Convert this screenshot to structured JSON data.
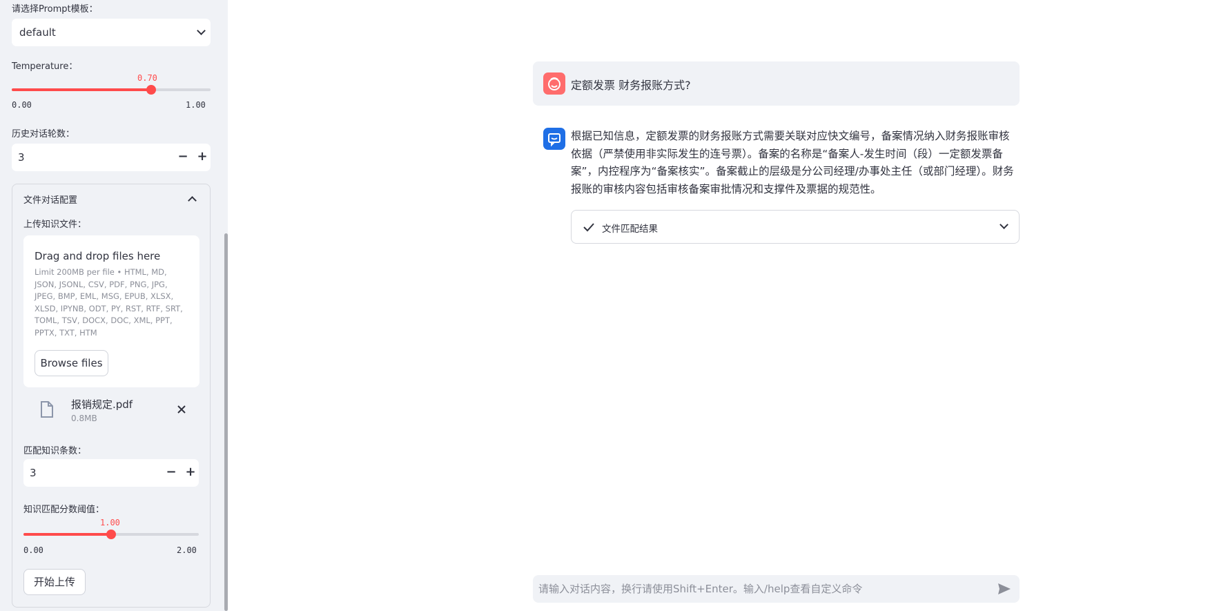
{
  "sidebar": {
    "prompt_template_label": "请选择Prompt模板：",
    "prompt_template_value": "default",
    "temperature_label": "Temperature：",
    "temperature_value": "0.70",
    "temperature_min": "0.00",
    "temperature_max": "1.00",
    "temperature_fraction": 0.7,
    "history_label": "历史对话轮数：",
    "history_value": "3",
    "file_config": {
      "title": "文件对话配置",
      "upload_label": "上传知识文件：",
      "drop_title": "Drag and drop files here",
      "drop_limit": "Limit 200MB per file • HTML, MD, JSON, JSONL, CSV, PDF, PNG, JPG, JPEG, BMP, EML, MSG, EPUB, XLSX, XLSD, IPYNB, ODT, PY, RST, RTF, SRT, TOML, TSV, DOCX, DOC, XML, PPT, PPTX, TXT, HTM",
      "browse_label": "Browse files",
      "file_name": "报销规定.pdf",
      "file_size": "0.8MB",
      "topk_label": "匹配知识条数：",
      "topk_value": "3",
      "threshold_label": "知识匹配分数阈值：",
      "threshold_value": "1.00",
      "threshold_min": "0.00",
      "threshold_max": "2.00",
      "threshold_fraction": 0.5,
      "upload_button": "开始上传"
    }
  },
  "chat": {
    "user_message": "定额发票 财务报账方式?",
    "assistant_message": "根据已知信息，定额发票的财务报账方式需要关联对应快文编号，备案情况纳入财务报账审核依据（严禁使用非实际发生的连号票）。备案的名称是“备案人-发生时间（段）一定额发票备案”，内控程序为“备案核实”。备案截止的层级是分公司经理/办事处主任（或部门经理）。财务报账的审核内容包括审核备案审批情况和支撑件及票据的规范性。",
    "result_expander": "文件匹配结果",
    "input_placeholder": "请输入对话内容，换行请使用Shift+Enter。输入/help查看自定义命令"
  },
  "colors": {
    "accent": "#ff4b4b",
    "sidebar_bg": "#f0f2f6",
    "user_avatar": "#ff6c6c",
    "bot_avatar": "#1f6fe6"
  }
}
